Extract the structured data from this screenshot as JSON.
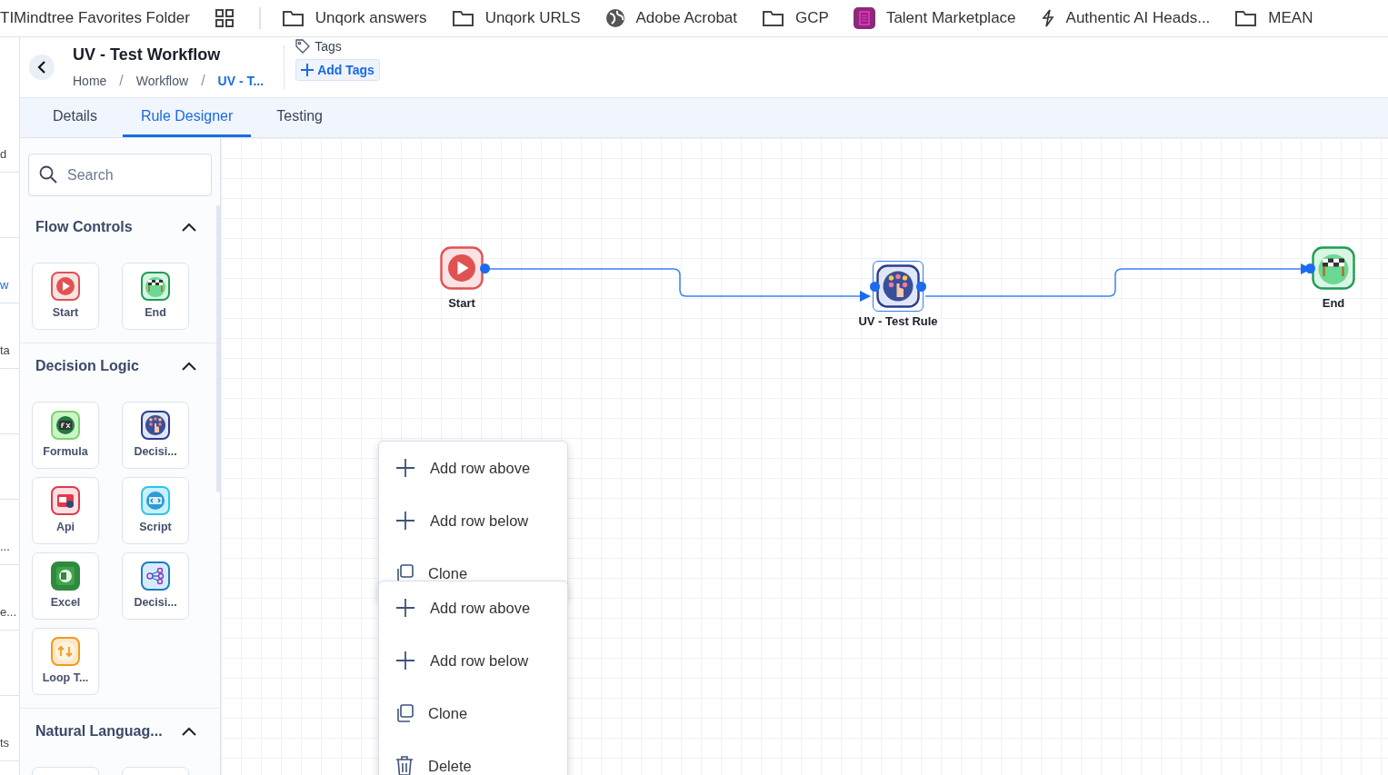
{
  "bookmarks": [
    {
      "kind": "text",
      "label": "TIMindtree Favorites Folder"
    },
    {
      "kind": "apps"
    },
    {
      "kind": "folder",
      "label": "Unqork answers"
    },
    {
      "kind": "folder",
      "label": "Unqork URLS"
    },
    {
      "kind": "globe",
      "label": "Adobe Acrobat"
    },
    {
      "kind": "folder",
      "label": "GCP"
    },
    {
      "kind": "app",
      "label": "Talent Marketplace"
    },
    {
      "kind": "bolt",
      "label": "Authentic AI Heads..."
    },
    {
      "kind": "folder",
      "label": "MEAN"
    }
  ],
  "left_strip": {
    "rows": [
      {
        "kind": "text",
        "text": "d"
      },
      {
        "kind": "blank"
      },
      {
        "kind": "link",
        "text": "w"
      },
      {
        "kind": "text",
        "text": "ta"
      },
      {
        "kind": "blank"
      },
      {
        "kind": "blank"
      },
      {
        "kind": "text",
        "text": "..."
      },
      {
        "kind": "text",
        "text": "e..."
      },
      {
        "kind": "blank"
      },
      {
        "kind": "text",
        "text": "ts"
      }
    ]
  },
  "page": {
    "title": "UV - Test Workflow",
    "breadcrumb": [
      {
        "label": "Home",
        "current": false
      },
      {
        "separator": "/",
        "label": "Workflow",
        "current": false
      },
      {
        "separator": "/",
        "label": "UV - T...",
        "current": true
      }
    ],
    "tags_label": "Tags",
    "add_tags": "Add Tags"
  },
  "tabs": [
    {
      "label": "Details",
      "selected": false
    },
    {
      "label": "Rule Designer",
      "selected": true
    },
    {
      "label": "Testing",
      "selected": false
    }
  ],
  "palette": {
    "search": {
      "placeholder": "Search"
    },
    "sections": [
      {
        "title": "Flow Controls",
        "expanded": true,
        "items": [
          {
            "kind": "start",
            "label": "Start"
          },
          {
            "kind": "end",
            "label": "End"
          }
        ]
      },
      {
        "title": "Decision Logic",
        "expanded": true,
        "items": [
          {
            "kind": "formula",
            "label": "Formula"
          },
          {
            "kind": "decision",
            "label": "Decisi..."
          },
          {
            "kind": "api",
            "label": "Api"
          },
          {
            "kind": "script",
            "label": "Script"
          },
          {
            "kind": "excel",
            "label": "Excel"
          },
          {
            "kind": "tree",
            "label": "Decisi..."
          },
          {
            "kind": "loop",
            "label": "Loop T..."
          }
        ]
      },
      {
        "title": "Natural Languag...",
        "expanded": true,
        "items": [
          {
            "kind": "nlp"
          },
          {
            "kind": "nlp"
          }
        ]
      }
    ]
  },
  "canvas": {
    "nodes": [
      {
        "kind": "start",
        "label": "Start",
        "selected": false
      },
      {
        "kind": "decision",
        "label": "UV - Test Rule",
        "selected": true
      },
      {
        "kind": "end",
        "label": "End",
        "selected": false
      }
    ]
  },
  "context_menus": [
    {
      "items": [
        {
          "kind": "add",
          "label": "Add row above"
        },
        {
          "kind": "add",
          "label": "Add row below"
        },
        {
          "kind": "clone",
          "label": "Clone"
        }
      ]
    },
    {
      "items": [
        {
          "kind": "add",
          "label": "Add row above"
        },
        {
          "kind": "add",
          "label": "Add row below"
        },
        {
          "kind": "clone",
          "label": "Clone"
        },
        {
          "kind": "delete",
          "label": "Delete"
        }
      ]
    }
  ]
}
